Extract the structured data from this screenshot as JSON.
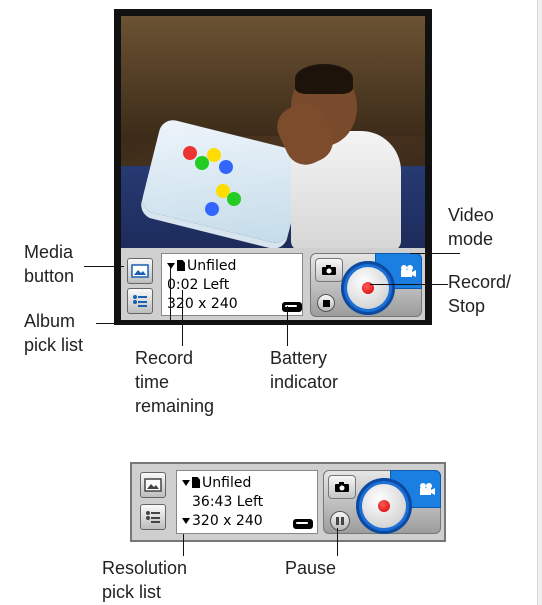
{
  "top_toolbar": {
    "album": "Unfiled",
    "time_left": "0:02 Left",
    "resolution": "320 x 240"
  },
  "bottom_toolbar": {
    "album": "Unfiled",
    "time_left": "36:43 Left",
    "resolution": "320 x 240"
  },
  "callouts": {
    "media_button": "Media button",
    "media_button_line1": "Media",
    "media_button_line2": "button",
    "album_pick_list_line1": "Album",
    "album_pick_list_line2": "pick list",
    "record_time_line1": "Record",
    "record_time_line2": "time",
    "record_time_line3": "remaining",
    "battery_line1": "Battery",
    "battery_line2": "indicator",
    "video_mode_line1": "Video",
    "video_mode_line2": "mode",
    "record_stop_line1": "Record/",
    "record_stop_line2": "Stop",
    "resolution_line1": "Resolution",
    "resolution_line2": "pick list",
    "pause": "Pause"
  },
  "icons": {
    "media": "media-icon",
    "album": "album-list-icon",
    "sd_card": "sd-card-icon",
    "battery": "battery-icon",
    "camera": "camera-icon",
    "video": "video-camera-icon",
    "record": "record-icon",
    "stop": "stop-icon",
    "pause": "pause-icon"
  },
  "colors": {
    "video_tab": "#1a7fe0",
    "record_ring": "#1d6fd6",
    "record_dot": "#d40000"
  }
}
